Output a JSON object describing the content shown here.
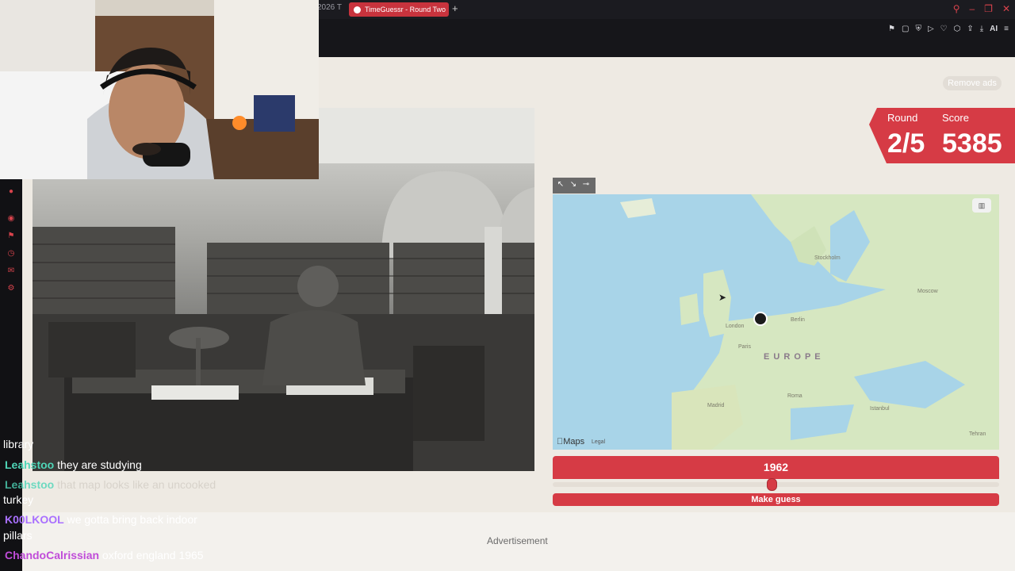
{
  "browser": {
    "prev_tab_fragment": "2026 T",
    "active_tab_title": "TimeGuessr - Round Two",
    "new_tab_icon": "plus-icon",
    "toolbar_ai_label": "AI"
  },
  "page": {
    "remove_ads_label": "Remove ads",
    "round_label": "Round",
    "score_label": "Score",
    "round_value": "2/5",
    "score_value": "5385",
    "map_region_label": "E U R O P E",
    "map_cities": [
      "Stockholm",
      "Moscow",
      "London",
      "Berlin",
      "Paris",
      "Roma",
      "Madrid",
      "Istanbul",
      "Tehran"
    ],
    "maps_brand": "Maps",
    "maps_legal": "Legal",
    "year_value": "1962",
    "year_slider_fraction": 0.49,
    "guess_button_label": "Make guess",
    "advertisement_label": "Advertisement"
  },
  "chat": {
    "messages": [
      {
        "user": "",
        "text": "library"
      },
      {
        "user": "Leahstoo",
        "text": "they are studying",
        "color": "#4fd6b8"
      },
      {
        "user": "Leahstoo",
        "text": "that map looks like an uncooked",
        "color": "#4fd6b8"
      },
      {
        "user": "",
        "text": "turkey"
      },
      {
        "user": "K00LKOOL",
        "text": "we gotta bring back indoor",
        "color": "#a970ff"
      },
      {
        "user": "",
        "text": "pillars"
      },
      {
        "user": "ChandoCalrissian",
        "text": "oxford england 1965",
        "color": "#c04cd9"
      }
    ]
  },
  "colors": {
    "accent_red": "#d63b45",
    "page_bg": "#eeeae3",
    "map_sea": "#a8d4e8",
    "map_land": "#d6e7c1"
  }
}
